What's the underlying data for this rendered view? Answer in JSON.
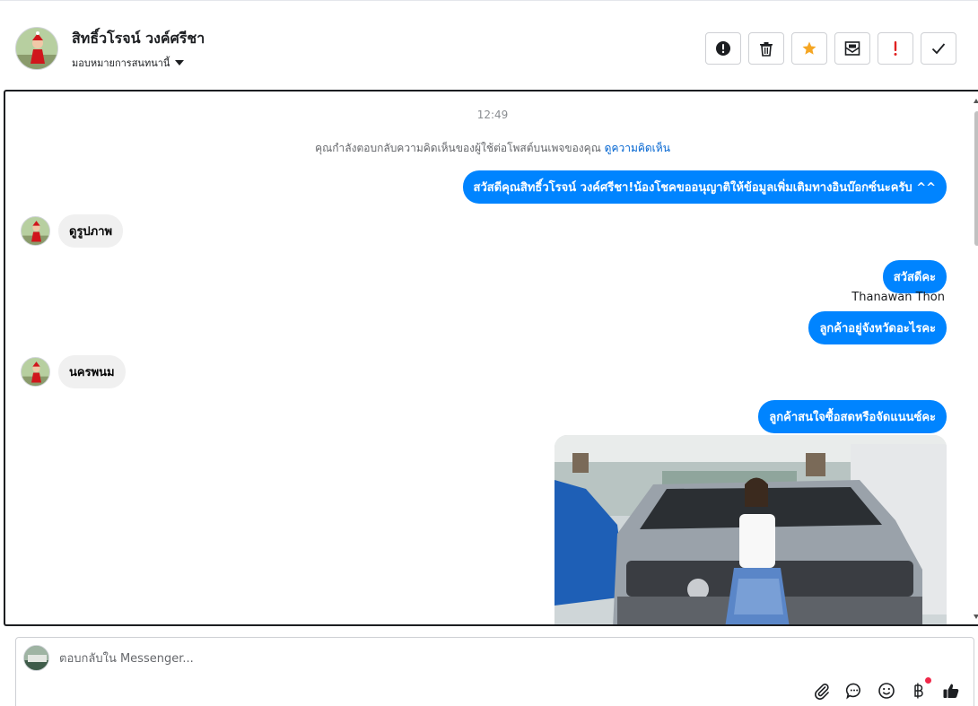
{
  "header": {
    "contact_name": "สิทธิ์วโรจน์ วงค์ศรีชา",
    "assign_label": "มอบหมายการสนทนานี้",
    "actions": [
      {
        "name": "mark-spam-button",
        "icon": "alert-circle-icon"
      },
      {
        "name": "delete-button",
        "icon": "trash-icon"
      },
      {
        "name": "star-button",
        "icon": "star-icon"
      },
      {
        "name": "mark-unread-button",
        "icon": "envelope-icon"
      },
      {
        "name": "follow-up-button",
        "icon": "exclamation-icon"
      },
      {
        "name": "done-button",
        "icon": "check-icon"
      }
    ],
    "star_color": "#f5a623",
    "follow_up_color": "#e02020"
  },
  "conversation": {
    "timestamp": "12:49",
    "notice_text": "คุณกำลังตอบกลับความคิดเห็นของผู้ใช้ต่อโพสต์บนเพจของคุณ ",
    "notice_link": "ดูความคิดเห็น",
    "messages": [
      {
        "direction": "out",
        "text": "สวัสดีคุณสิทธิ์วโรจน์ วงค์ศรีชา!น้องโชคขออนุญาติให้ข้อมูลเพิ่มเติมทางอินบ๊อกซ์นะครับ ^^"
      },
      {
        "direction": "in",
        "text": "ดูรูปภาพ"
      },
      {
        "direction": "out",
        "text": "สวัสดีคะ"
      },
      {
        "direction": "out",
        "sender": "Thanawan Thon",
        "text": "ลูกค้าอยู่จังหวัดอะไรคะ"
      },
      {
        "direction": "in",
        "text": "นครพนม"
      },
      {
        "direction": "out",
        "text": "ลูกค้าสนใจซื้อสดหรือจัดแนนซ์คะ"
      }
    ],
    "outgoing_color": "#0084ff",
    "incoming_color": "#f0f0f0"
  },
  "composer": {
    "placeholder": "ตอบกลับใน Messenger...",
    "value": "",
    "tools": [
      "paperclip-icon",
      "chat-bubble-icon",
      "emoji-icon",
      "baht-icon",
      "thumbs-up-icon"
    ]
  }
}
